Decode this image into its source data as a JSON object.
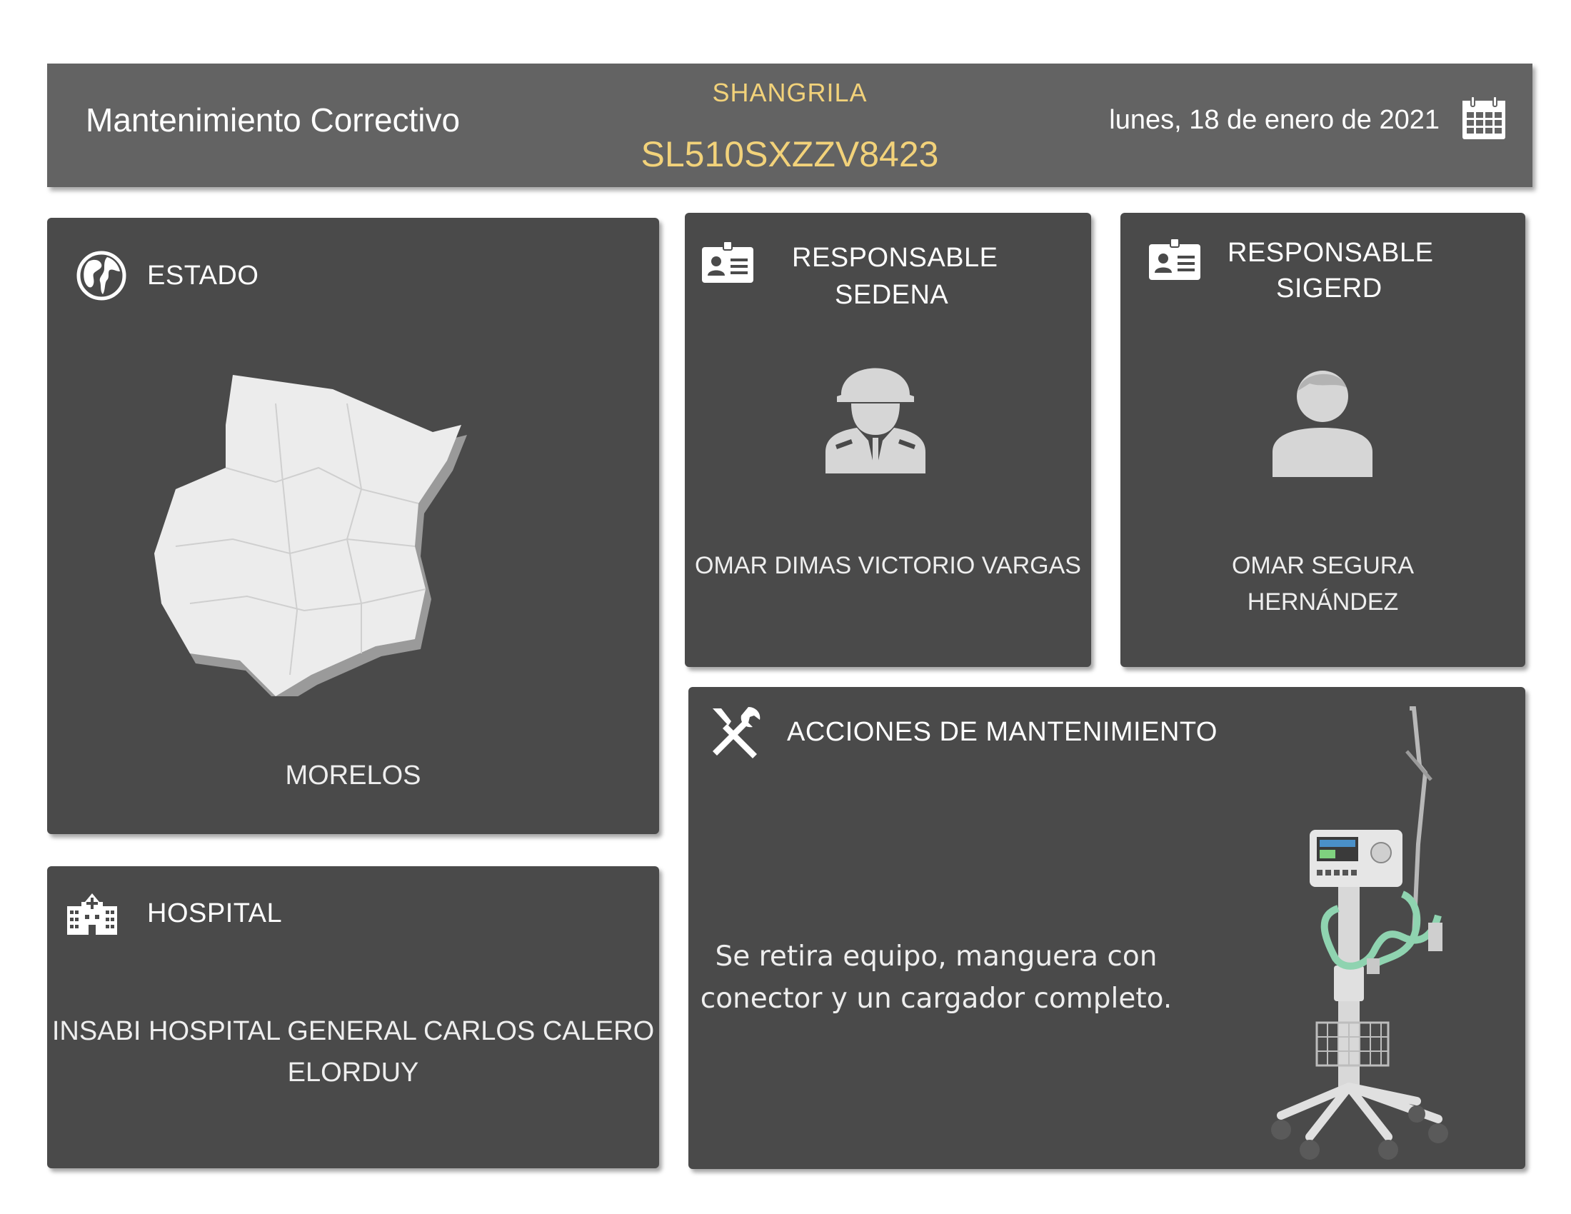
{
  "header": {
    "title": "Mantenimiento Correctivo",
    "brand": "SHANGRILA",
    "serial": "SL510SXZZV8423",
    "date": "lunes, 18 de enero de 2021"
  },
  "estado": {
    "label": "ESTADO",
    "value": "MORELOS"
  },
  "sedena": {
    "label_line1": "RESPONSABLE",
    "label_line2": "SEDENA",
    "name": "OMAR DIMAS VICTORIO VARGAS"
  },
  "sigerd": {
    "label_line1": "RESPONSABLE",
    "label_line2": "SIGERD",
    "name_line1": "OMAR SEGURA",
    "name_line2": "HERNÁNDEZ"
  },
  "hospital": {
    "label": "HOSPITAL",
    "name_line1": "INSABI HOSPITAL GENERAL CARLOS CALERO",
    "name_line2": "ELORDUY"
  },
  "acciones": {
    "label": "ACCIONES DE MANTENIMIENTO",
    "text_line1": "Se retira equipo, manguera con",
    "text_line2": "conector y un cargador completo."
  },
  "colors": {
    "panel": "#4a4a4a",
    "header": "#636363",
    "accent": "#f2d27a",
    "icon": "#e6e6e6"
  },
  "icons": [
    "calendar-icon",
    "globe-icon",
    "id-card-icon",
    "soldier-icon",
    "person-icon",
    "hospital-icon",
    "tools-icon",
    "map-icon",
    "ventilator-icon"
  ]
}
